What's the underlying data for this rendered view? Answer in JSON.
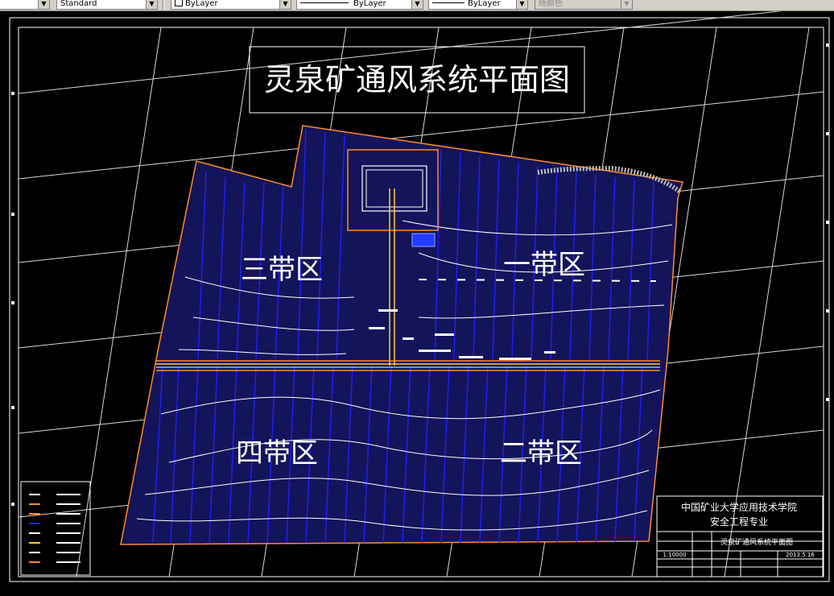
{
  "toolbar": {
    "text_style": "Standard",
    "layer_color": "ByLayer",
    "linetype": "ByLayer",
    "lineweight": "ByLayer",
    "plot_style": "随颜色"
  },
  "drawing": {
    "title": "灵泉矿通风系统平面图",
    "zones": {
      "zone3": "三带区",
      "zone1": "一带区",
      "zone4": "四带区",
      "zone2": "二带区"
    },
    "title_block": {
      "school": "中国矿业大学应用技术学院",
      "major": "安全工程专业",
      "drawing_name": "灵泉矿通风系统平面图",
      "scale": "1:10000",
      "date": "2013.5.16"
    }
  },
  "colors": {
    "background": "#000000",
    "boundary": "#ff8c2a",
    "fill": "#14145a",
    "blue_lines": "#1f1fff",
    "contours": "#ffffff"
  }
}
